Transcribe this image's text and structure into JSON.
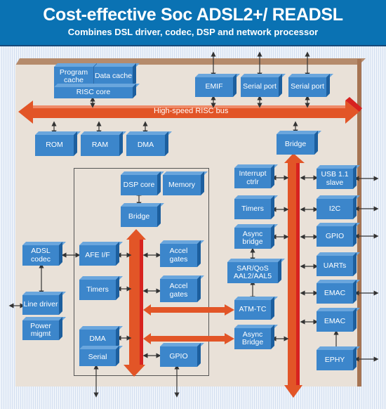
{
  "header": {
    "title": "Cost-effective Soc ADSL2+/ READSL",
    "subtitle": "Combines DSL driver, codec, DSP and network processor"
  },
  "colors": {
    "header_bg": "#0a72b3",
    "block": "#3c86cb",
    "bus": "#e25527",
    "bus_dark": "#d7221f",
    "board": "#e9e1d8"
  },
  "bus": {
    "label": "High-speed RISC bus"
  },
  "blocks": {
    "program_cache": "Program cache",
    "data_cache": "Data cache",
    "risc_core": "RISC core",
    "emif": "EMIF",
    "serial_port_1": "Serial port",
    "serial_port_2": "Serial port",
    "rom": "ROM",
    "ram": "RAM",
    "dma_top": "DMA",
    "bridge_right": "Bridge",
    "dsp_core": "DSP core",
    "memory": "Memory",
    "bridge_dsp": "Bridge",
    "adsl_codec": "ADSL codec",
    "afe_if": "AFE I/F",
    "accel_gates_1": "Accel gates",
    "timers_dsp": "Timers",
    "accel_gates_2": "Accel gates",
    "line_driver": "Line driver",
    "power_mgmt": "Power migmt",
    "dma_dsp": "DMA",
    "serial_dsp": "Serial",
    "gpio_dsp": "GPIO",
    "interrupt_ctrl": "Interrupt ctrlr",
    "timers_right": "Timers",
    "async_bridge_1": "Async bridge",
    "sar_qos": "SAR/QoS AAL2/AAL5",
    "atm_tc": "ATM-TC",
    "async_bridge_2": "Async Bridge",
    "usb": "USB 1.1 slave",
    "i2c": "I2C",
    "gpio_right": "GPIO",
    "uarts": "UARTs",
    "emac_1": "EMAC",
    "emac_2": "EMAC",
    "ephy": "EPHY"
  }
}
